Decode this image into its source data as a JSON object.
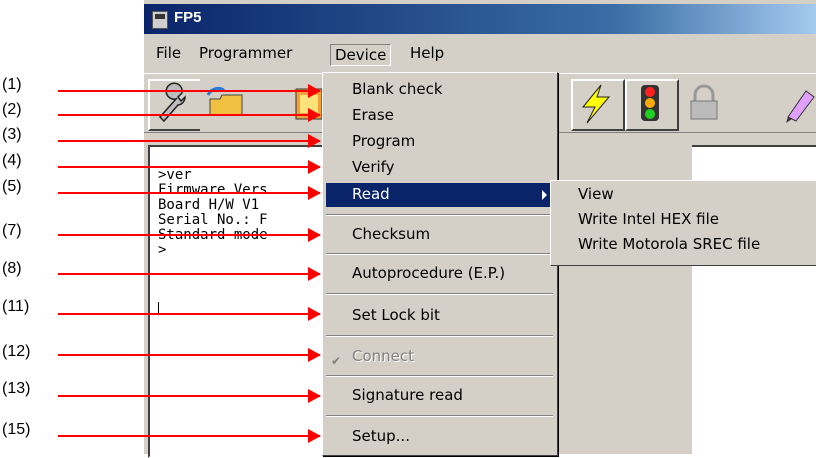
{
  "window": {
    "title": "FP5"
  },
  "menubar": {
    "file": "File",
    "programmer": "Programmer",
    "device": "Device",
    "help": "Help"
  },
  "toolbar": {
    "icons": [
      "wrench-icon",
      "open-folder-icon",
      "book-icon",
      "lightning-icon",
      "traffic-light-icon",
      "lock-icon",
      "pencil-icon"
    ]
  },
  "console": {
    "lines": [
      ">ver",
      "Firmware Vers",
      "Board H/W V1",
      "Serial No.: F",
      "Standard mode",
      ">"
    ]
  },
  "device_menu": {
    "items": [
      "Blank check",
      "Erase",
      "Program",
      "Verify",
      "Read",
      "Checksum",
      "Autoprocedure (E.P.)",
      "Set Lock bit",
      "Connect",
      "Signature read",
      "Setup..."
    ]
  },
  "read_submenu": {
    "items": [
      "View",
      "Write Intel HEX file",
      "Write Motorola SREC file"
    ]
  },
  "callouts": [
    "(1)",
    "(2)",
    "(3)",
    "(4)",
    "(5)",
    "(7)",
    "(8)",
    "(11)",
    "(12)",
    "(13)",
    "(15)"
  ],
  "colors": {
    "arrow": "#ff0000",
    "highlight": "#0a246a",
    "titlebar": "#0a246a",
    "face": "#d4d0c8"
  }
}
